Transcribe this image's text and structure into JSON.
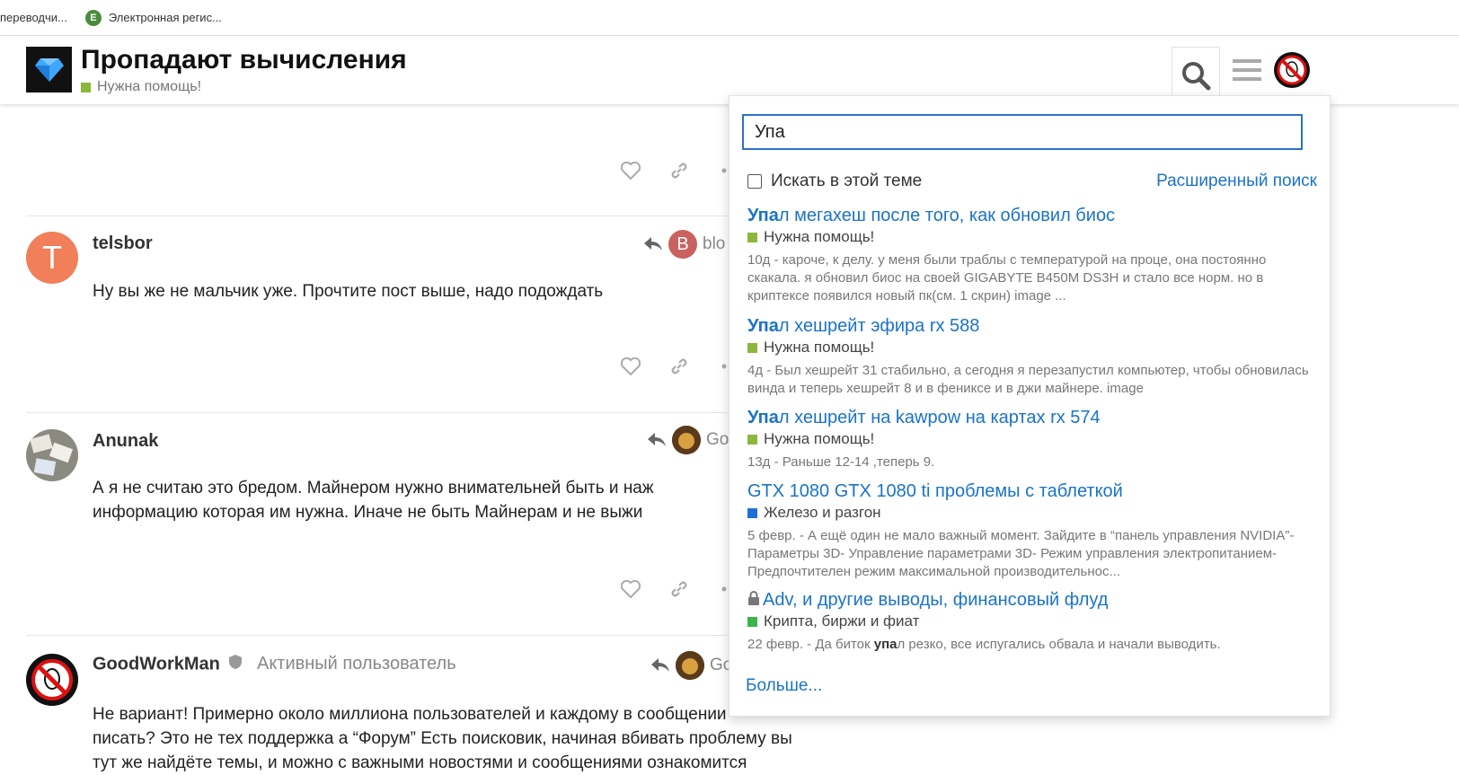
{
  "bookmarks": [
    {
      "label": "переводчи..."
    },
    {
      "label": "Электронная регис..."
    }
  ],
  "header": {
    "title": "Пропадают вычисления",
    "category": "Нужна помощь!",
    "category_color": "#8db63c"
  },
  "posts": [
    {
      "username": "telsbor",
      "avatar_letter": "T",
      "avatar_color": "#f07f5a",
      "reply_to_letter": "B",
      "reply_to_color": "#c9625f",
      "reply_to_name": "blo",
      "body": "Ну вы же не мальчик уже. Прочтите пост выше, надо подождать"
    },
    {
      "username": "Anunak",
      "reply_to_name": "Go",
      "body_line1": "А я не считаю это бредом. Майнером нужно внимательней быть и наж",
      "body_line2": "информацию которая им нужна. Иначе не быть Майнерам и не выжи"
    },
    {
      "username": "GoodWorkMan",
      "user_title": "Активный пользователь",
      "reply_to_name": "Go",
      "body_line1": "Не вариант! Примерно около миллиона пользователей и каждому в сообщении",
      "body_line2": "писать? Это не тех поддержка а “Форум” Есть поисковик, начиная вбивать проблему вы",
      "body_line3": "тут же найдёте темы, и можно с важными новостями и сообщениями ознакомится"
    }
  ],
  "search": {
    "query": "Упа",
    "context_label": "Искать в этой теме",
    "advanced_label": "Расширенный поиск",
    "more_label": "Больше...",
    "results": [
      {
        "title_highlight": "Упа",
        "title_rest": "л мегахеш после того, как обновил биос",
        "category": "Нужна помощь!",
        "category_color": "#8db63c",
        "blurb": "10д - кароче, к делу. у меня были траблы с температурой на проце, она постоянно скакала. я обновил биос на своей GIGABYTE B450M DS3H и стало все норм. но в криптексе появился новый пк(см. 1 скрин) image ..."
      },
      {
        "title_highlight": "Упа",
        "title_rest": "л хешрейт эфира rx 588",
        "category": "Нужна помощь!",
        "category_color": "#8db63c",
        "blurb": "4д - Был хешрейт 31 стабильно, а сегодня я перезапустил компьютер, чтобы обновилась винда и теперь хешрейт 8 и в фениксе и в джи майнере. image"
      },
      {
        "title_highlight": "Упа",
        "title_rest": "л хешрейт на kawpow на картах rx 574",
        "category": "Нужна помощь!",
        "category_color": "#8db63c",
        "blurb": "13д - Раньше 12-14 ,теперь 9."
      },
      {
        "title_highlight": "",
        "title_rest": "GTX 1080 GTX 1080 ti проблемы с таблеткой",
        "category": "Железо и разгон",
        "category_color": "#1f6fd9",
        "blurb": "5 февр. - А ещё один не мало важный момент. Зайдите в “панель управления NVIDIA”- Параметры 3D- Управление параметрами 3D- Режим управления электропитанием- Предпочтителен режим максимальной производительнос..."
      },
      {
        "title_highlight": "",
        "title_rest": "Adv, и другие выводы, финансовый флуд",
        "category": "Крипта, биржи и фиат",
        "category_color": "#3ab54a",
        "blurb_prefix": "22 февр. - Да биток ",
        "blurb_highlight": "упа",
        "blurb_suffix": "л резко, все испугались обвала и начали выводить."
      }
    ]
  }
}
